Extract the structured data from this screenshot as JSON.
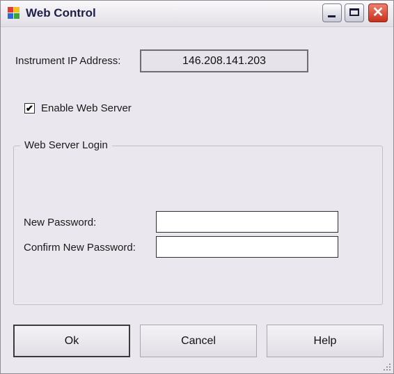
{
  "window": {
    "title": "Web Control"
  },
  "titlebar": {
    "minimize_icon": "minimize-icon",
    "maximize_icon": "maximize-icon",
    "close_icon": "close-icon",
    "close_glyph": "✕"
  },
  "instrument": {
    "ip_label": "Instrument IP Address:",
    "ip_value": "146.208.141.203"
  },
  "web_server": {
    "enable_label": "Enable Web Server",
    "enabled": true,
    "check_glyph": "✔"
  },
  "login": {
    "group_title": "Web Server Login",
    "new_password_label": "New Password:",
    "new_password_value": "",
    "confirm_password_label": "Confirm New Password:",
    "confirm_password_value": ""
  },
  "buttons": {
    "ok": "Ok",
    "cancel": "Cancel",
    "help": "Help"
  },
  "colors": {
    "close_button": "#c6301c",
    "window_bg": "#ebe7ee",
    "title_text": "#1d1f46"
  }
}
